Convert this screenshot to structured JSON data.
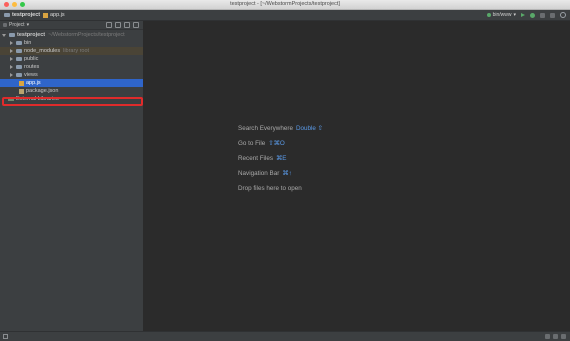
{
  "window": {
    "title": "testproject - [~/WebstormProjects/testproject]"
  },
  "navbar": {
    "project": "testproject",
    "file": "app.js",
    "run_config": "bin/www"
  },
  "sidebar": {
    "view_selector": "Project",
    "tree": {
      "root_name": "testproject",
      "root_path": "~/WebstormProjects/testproject",
      "items": [
        {
          "name": "bin",
          "type": "folder"
        },
        {
          "name": "node_modules",
          "type": "folder",
          "note": "library root"
        },
        {
          "name": "public",
          "type": "folder"
        },
        {
          "name": "routes",
          "type": "folder"
        },
        {
          "name": "views",
          "type": "folder"
        },
        {
          "name": "app.js",
          "type": "js",
          "selected": true
        },
        {
          "name": "package.json",
          "type": "json"
        }
      ],
      "external": "External Libraries"
    }
  },
  "editor": {
    "hints": [
      {
        "label": "Search Everywhere",
        "shortcut": "Double ⇧"
      },
      {
        "label": "Go to File",
        "shortcut": "⇧⌘O"
      },
      {
        "label": "Recent Files",
        "shortcut": "⌘E"
      },
      {
        "label": "Navigation Bar",
        "shortcut": "⌘↑"
      },
      {
        "label": "Drop files here to open",
        "shortcut": ""
      }
    ]
  },
  "colors": {
    "selection": "#2f65ca",
    "annotation": "#e02b2b",
    "shortcut": "#5a9ae8"
  }
}
